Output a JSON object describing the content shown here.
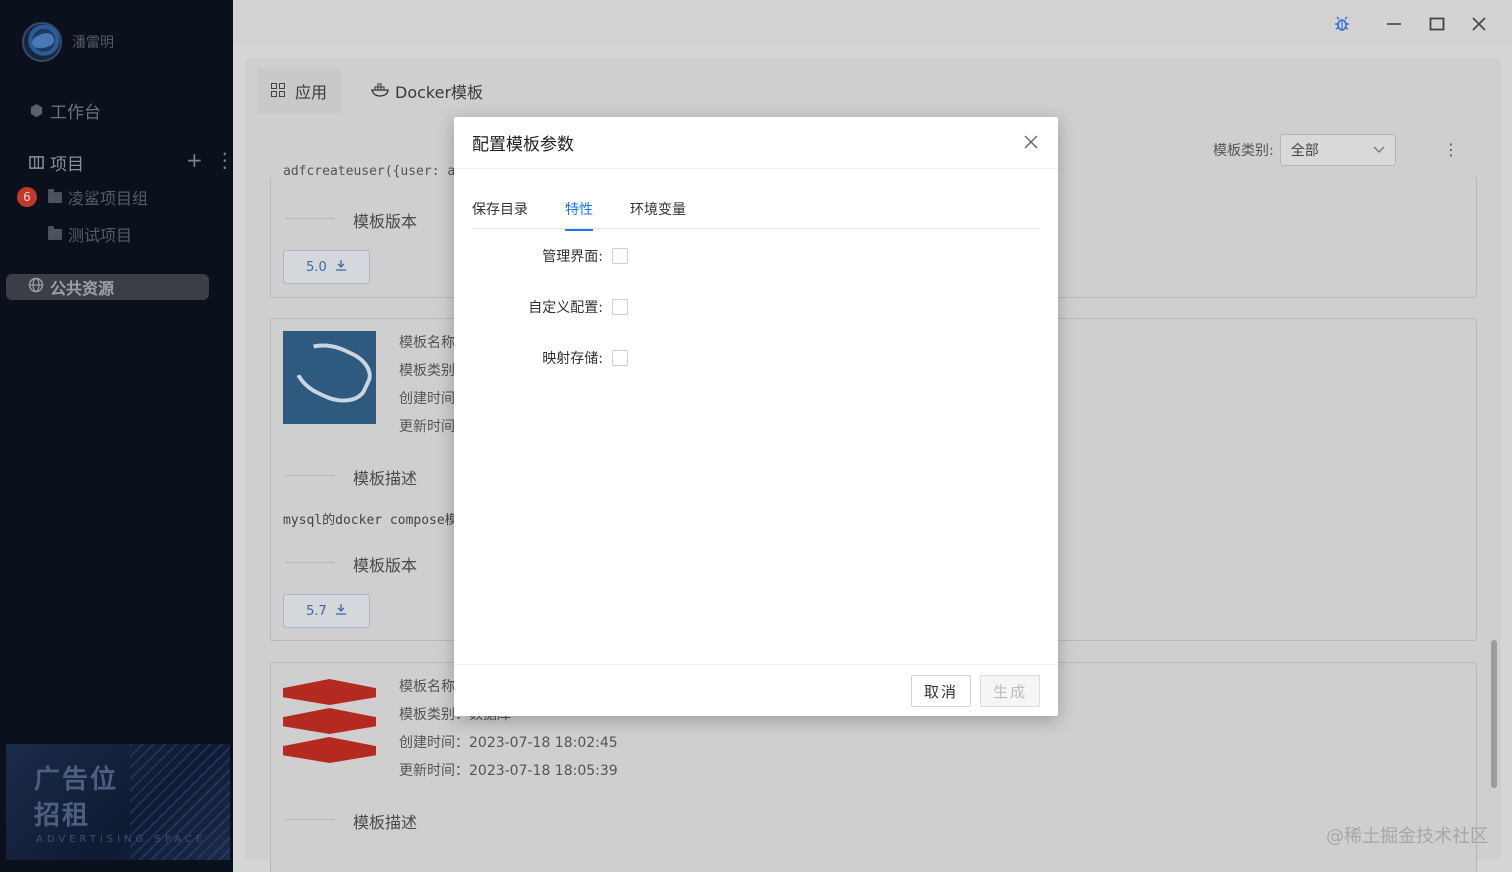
{
  "user": {
    "name": "潘雷明"
  },
  "sidebar": {
    "workbench": "工作台",
    "projects_title": "项目",
    "projects": [
      {
        "label": "凌鲨项目组",
        "badge": "6"
      },
      {
        "label": "测试项目"
      }
    ],
    "public_resources": "公共资源",
    "ad": {
      "line1": "广告位",
      "line2": "招租",
      "sub": "ADVERTISING SPACE"
    }
  },
  "tabs": [
    {
      "label": "应用"
    },
    {
      "label": "Docker模板"
    }
  ],
  "filter": {
    "label": "模板类别:",
    "value": "全部"
  },
  "cards": [
    {
      "partial_text": "adfcreateuser({user: a",
      "version_label": "模板版本",
      "version": "5.0"
    },
    {
      "meta": [
        "模板名称",
        "模板类别",
        "创建时间",
        "更新时间"
      ],
      "desc_label": "模板描述",
      "desc": "mysql的docker compose模",
      "version_label": "模板版本",
      "version": "5.7"
    },
    {
      "meta": [
        "模板名称",
        "模板类别：数据库",
        "创建时间：2023-07-18 18:02:45",
        "更新时间：2023-07-18 18:05:39"
      ],
      "desc_label": "模板描述"
    }
  ],
  "watermark": "@稀土掘金技术社区",
  "modal": {
    "title": "配置模板参数",
    "tabs": [
      "保存目录",
      "特性",
      "环境变量"
    ],
    "active_tab": 1,
    "fields": [
      {
        "label": "管理界面:",
        "checked": false
      },
      {
        "label": "自定义配置:",
        "checked": false
      },
      {
        "label": "映射存储:",
        "checked": false
      }
    ],
    "cancel": "取消",
    "generate": "生成"
  },
  "colors": {
    "accent": "#1677ff",
    "sidebar_bg": "#0b111c",
    "badge": "#c0392b"
  }
}
